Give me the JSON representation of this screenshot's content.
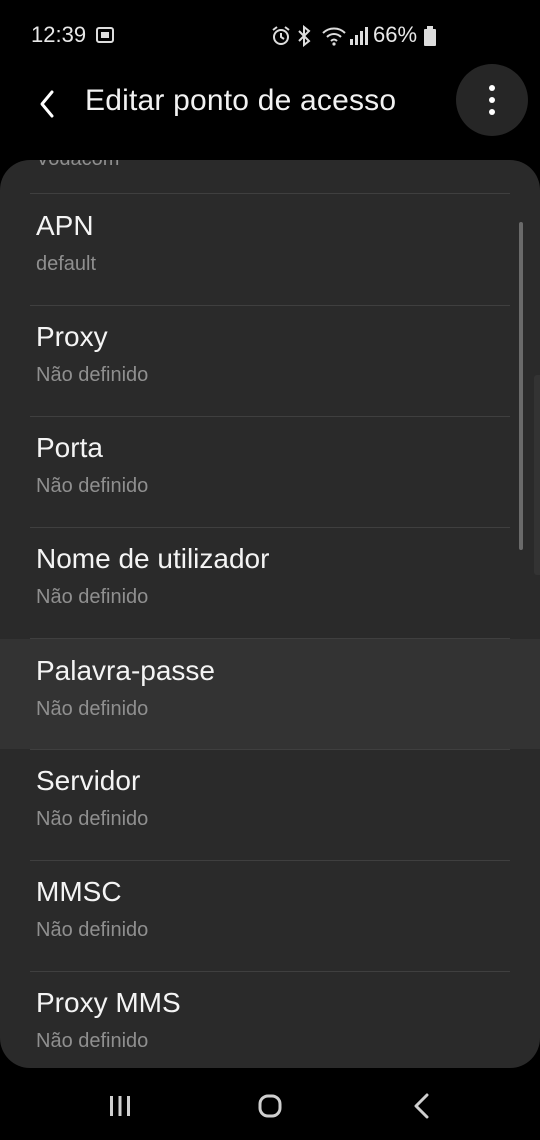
{
  "status_bar": {
    "time": "12:39",
    "battery_percent": "66%",
    "icons": [
      "screenshot-icon",
      "alarm-icon",
      "bluetooth-icon",
      "wifi-icon",
      "signal-icon",
      "battery-icon"
    ]
  },
  "app_bar": {
    "title": "Editar ponto de acesso",
    "back_icon": "back-arrow-icon",
    "more_icon": "more-options-icon"
  },
  "list": {
    "partial_item": "Vodacom",
    "items": [
      {
        "title": "APN",
        "value": "default"
      },
      {
        "title": "Proxy",
        "value": "Não definido"
      },
      {
        "title": "Porta",
        "value": "Não definido"
      },
      {
        "title": "Nome de utilizador",
        "value": "Não definido"
      },
      {
        "title": "Palavra-passe",
        "value": "Não definido"
      },
      {
        "title": "Servidor",
        "value": "Não definido"
      },
      {
        "title": "MMSC",
        "value": "Não definido"
      },
      {
        "title": "Proxy MMS",
        "value": "Não definido"
      }
    ]
  },
  "nav_bar": {
    "icons": [
      "recent-apps-icon",
      "home-icon",
      "back-icon"
    ]
  },
  "colors": {
    "background": "#000000",
    "panel": "#2a2a2a",
    "highlight": "#333333",
    "primary_text": "#f4f4f4",
    "secondary_text": "#8f8f8f"
  }
}
